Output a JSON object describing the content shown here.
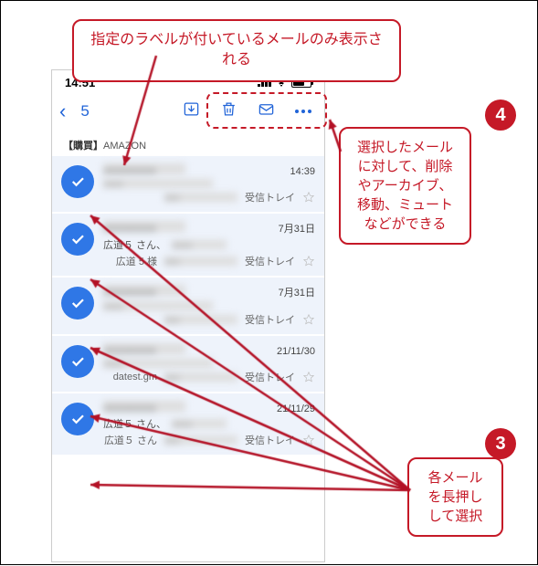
{
  "statusbar": {
    "time": "14:51"
  },
  "navbar": {
    "back_glyph": "‹",
    "selected_count": "5"
  },
  "section": {
    "tag": "【購買】",
    "label": "AMAZON"
  },
  "inbox_label": "受信トレイ",
  "mails": [
    {
      "time": "14:39",
      "line2a": "",
      "line2b": ""
    },
    {
      "time": "7月31日",
      "line2a": "広道５ さん、",
      "line2b": "広道 5 様"
    },
    {
      "time": "7月31日",
      "line2a": "",
      "line2b": ""
    },
    {
      "time": "21/11/30",
      "line2a": "",
      "line2b": "datest.gm"
    },
    {
      "time": "21/11/29",
      "line2a": "広道５ さん、",
      "line2b": "広道５ さん"
    }
  ],
  "callouts": {
    "top": "指定のラベルが付いているメールのみ表示される",
    "right1": "選択したメールに対して、削除やアーカイブ、移動、ミュートなどができる",
    "right2": "各メールを長押しして選択",
    "badge4": "4",
    "badge3": "3"
  }
}
